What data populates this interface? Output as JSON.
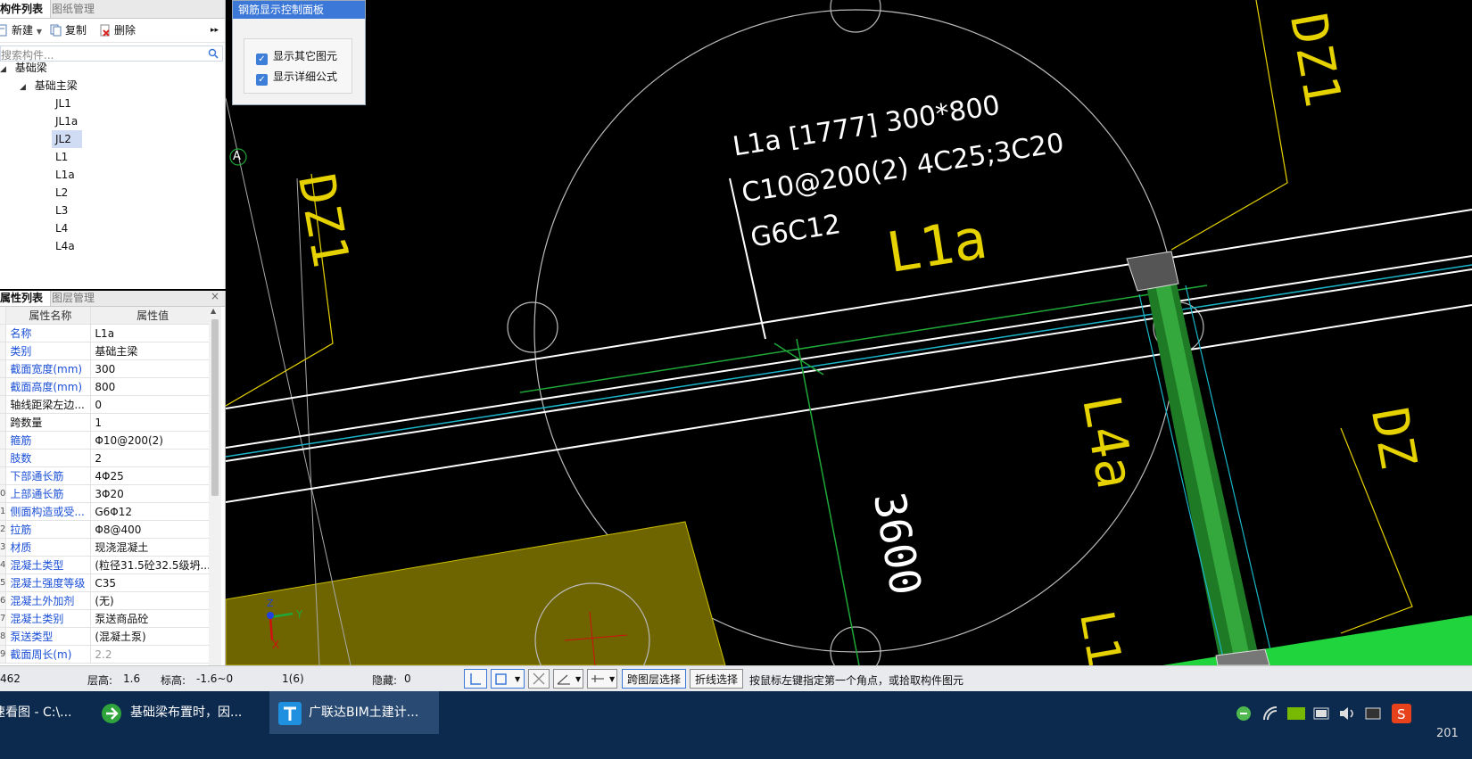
{
  "component_panel": {
    "tabs": [
      "构件列表",
      "图纸管理"
    ],
    "toolbar": {
      "new_label": "新建",
      "copy_label": "复制",
      "delete_label": "删除",
      "more": "▸▸"
    },
    "search_placeholder": "搜索构件...",
    "tree": {
      "root": "基础梁",
      "group": "基础主梁",
      "items": [
        "JL1",
        "JL1a",
        "JL2",
        "L1",
        "L1a",
        "L2",
        "L3",
        "L4",
        "L4a"
      ],
      "selected": "JL2"
    }
  },
  "property_panel": {
    "tabs": [
      "属性列表",
      "图层管理"
    ],
    "close": "×",
    "columns": [
      "属性名称",
      "属性值"
    ],
    "rows": [
      {
        "num": "",
        "name": "名称",
        "value": "L1a",
        "blue": true
      },
      {
        "num": "",
        "name": "类别",
        "value": "基础主梁",
        "blue": true
      },
      {
        "num": "",
        "name": "截面宽度(mm)",
        "value": "300",
        "blue": true
      },
      {
        "num": "",
        "name": "截面高度(mm)",
        "value": "800",
        "blue": true
      },
      {
        "num": "",
        "name": "轴线距梁左边...",
        "value": "0",
        "blue": false
      },
      {
        "num": "",
        "name": "跨数量",
        "value": "1",
        "blue": false
      },
      {
        "num": "",
        "name": "箍筋",
        "value": "Φ10@200(2)",
        "blue": true
      },
      {
        "num": "",
        "name": "肢数",
        "value": "2",
        "blue": true
      },
      {
        "num": "",
        "name": "下部通长筋",
        "value": "4Φ25",
        "blue": true
      },
      {
        "num": "0",
        "name": "上部通长筋",
        "value": "3Φ20",
        "blue": true
      },
      {
        "num": "1",
        "name": "侧面构造或受...",
        "value": "G6Φ12",
        "blue": true
      },
      {
        "num": "2",
        "name": "拉筋",
        "value": "Φ8@400",
        "blue": true
      },
      {
        "num": "3",
        "name": "材质",
        "value": "现浇混凝土",
        "blue": true
      },
      {
        "num": "4",
        "name": "混凝土类型",
        "value": "(粒径31.5砼32.5级坍...",
        "blue": true
      },
      {
        "num": "5",
        "name": "混凝土强度等级",
        "value": "C35",
        "blue": true
      },
      {
        "num": "6",
        "name": "混凝土外加剂",
        "value": "(无)",
        "blue": true
      },
      {
        "num": "7",
        "name": "混凝土类别",
        "value": "泵送商品砼",
        "blue": true
      },
      {
        "num": "8",
        "name": "泵送类型",
        "value": "(混凝土泵)",
        "blue": true
      },
      {
        "num": "9",
        "name": "截面周长(m)",
        "value": "2.2",
        "blue": true,
        "grey_value": true
      }
    ]
  },
  "control_panel": {
    "title": "钢筋显示控制面板",
    "options": [
      {
        "label": "显示其它图元",
        "checked": true
      },
      {
        "label": "显示详细公式",
        "checked": true
      }
    ]
  },
  "canvas": {
    "annotation": [
      "L1a [1777] 300*800",
      "C10@200(2) 4C25;3C20",
      "G6C12"
    ],
    "axis_label": "A",
    "axis_x": "Y",
    "axis_y": "X",
    "axis_z": "Z",
    "yellow_labels": [
      "DZ1",
      "DZ1",
      "L1a",
      "L4a",
      "3600",
      "L1",
      "DZ"
    ]
  },
  "statusbar": {
    "coord": "462",
    "floor_height_label": "层高:",
    "floor_height": "1.6",
    "elevation_label": "标高:",
    "elevation": "-1.6~0",
    "count": "1(6)",
    "hidden_label": "隐藏:",
    "hidden": "0",
    "cross_layer_btn": "跨图层选择",
    "polyline_btn": "折线选择",
    "hint": "按鼠标左键指定第一个角点，或拾取构件图元"
  },
  "taskbar": {
    "items": [
      "速看图 - C:\\...",
      "基础梁布置时，因...",
      "广联达BIM土建计..."
    ],
    "clock": "201"
  },
  "colors": {
    "accent": "#3c78d8",
    "canvas_bg": "#000000",
    "yellow": "#e6d200",
    "green": "#1fa838"
  }
}
